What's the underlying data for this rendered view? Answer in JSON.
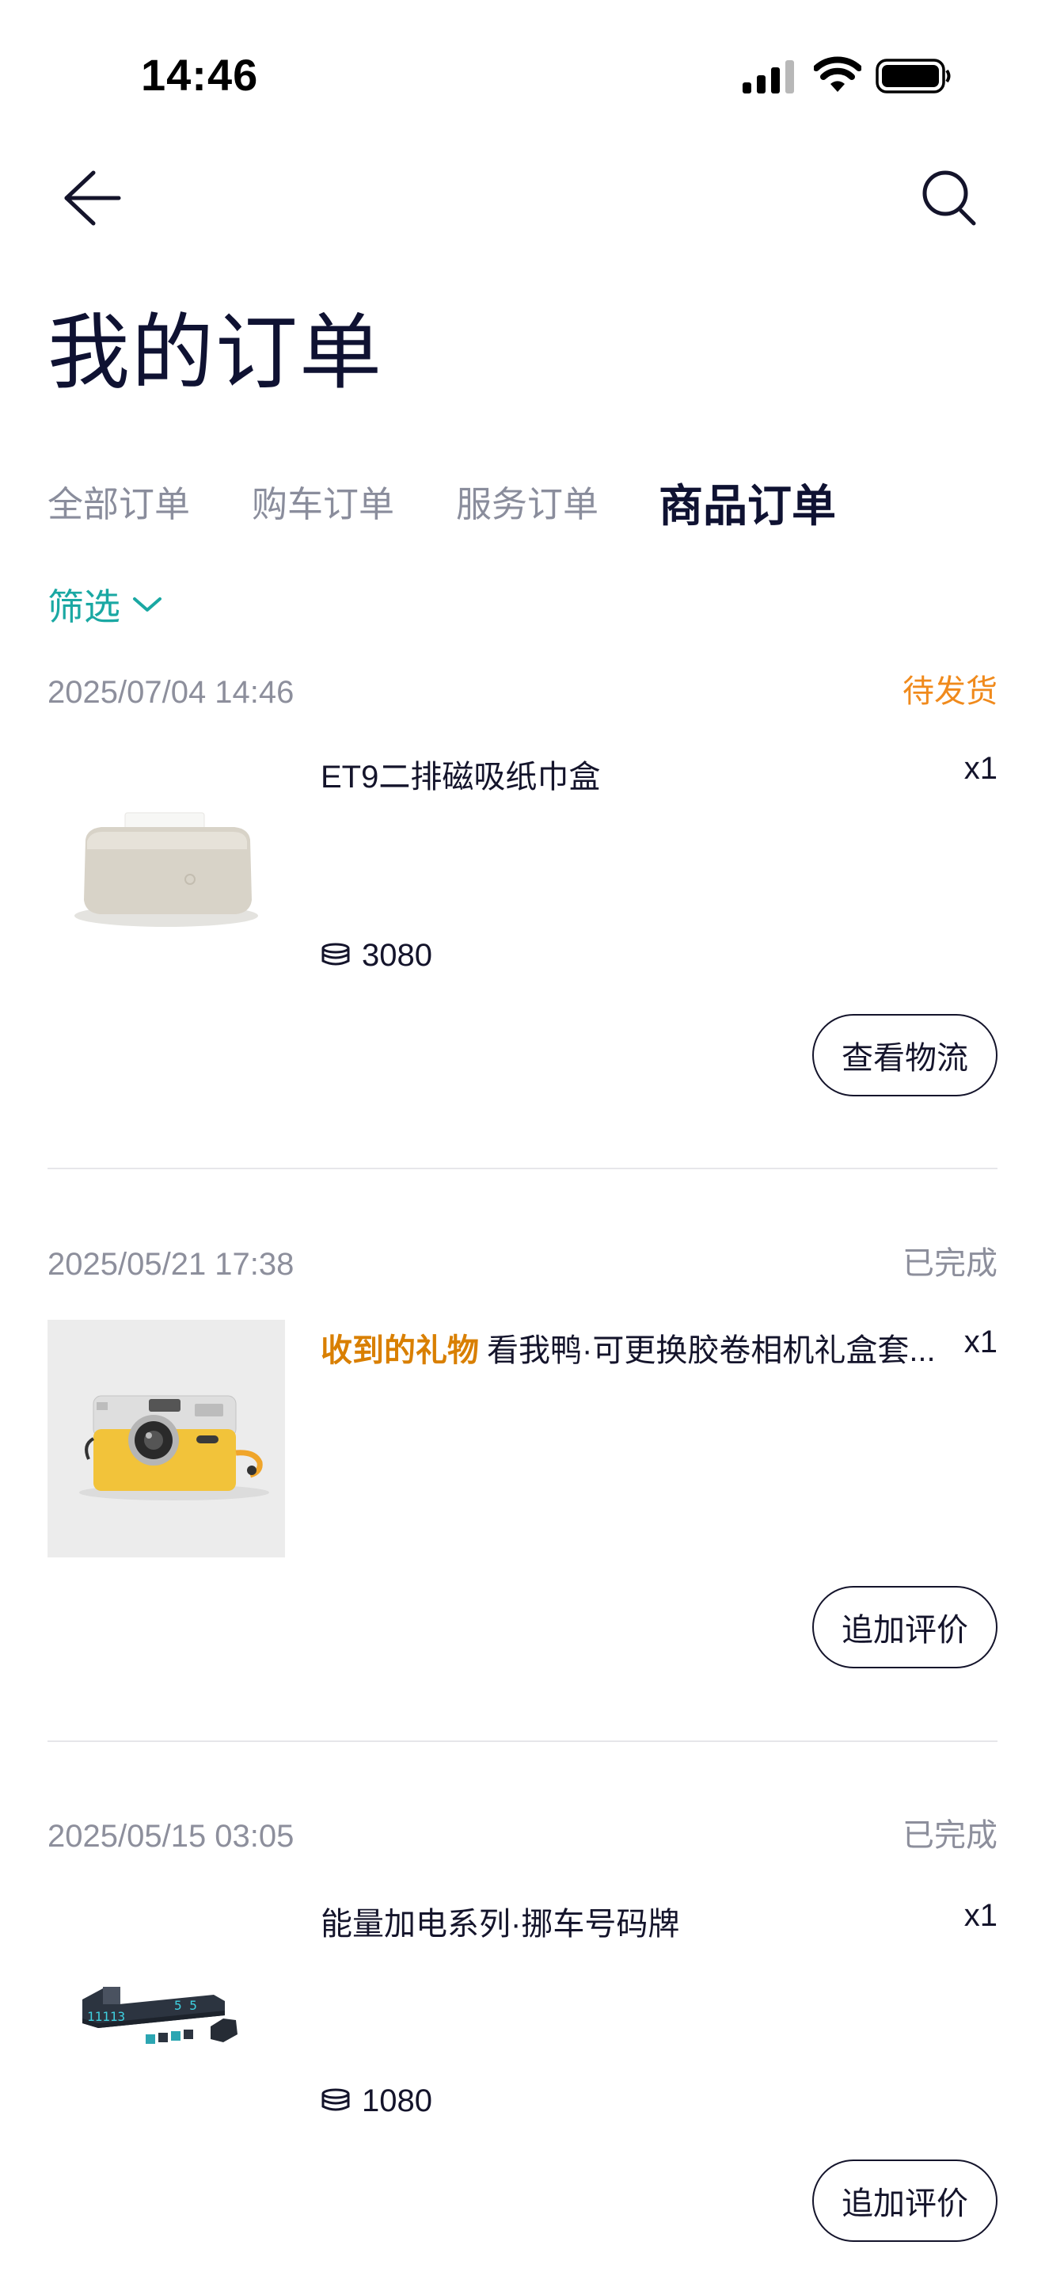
{
  "status_bar": {
    "time": "14:46"
  },
  "header": {
    "title": "我的订单"
  },
  "tabs": [
    {
      "label": "全部订单"
    },
    {
      "label": "购车订单"
    },
    {
      "label": "服务订单"
    },
    {
      "label": "商品订单"
    }
  ],
  "filter": {
    "label": "筛选"
  },
  "orders": [
    {
      "date": "2025/07/04 14:46",
      "status": "待发货",
      "status_color": "#f08a1c",
      "gift_tag": "",
      "title": "ET9二排磁吸纸巾盒",
      "qty": "x1",
      "price": "3080",
      "button": "查看物流"
    },
    {
      "date": "2025/05/21 17:38",
      "status": "已完成",
      "status_color": "#8d8f9c",
      "gift_tag": "收到的礼物",
      "title": "看我鸭·可更换胶卷相机礼盒套...",
      "qty": "x1",
      "price": "",
      "button": "追加评价"
    },
    {
      "date": "2025/05/15 03:05",
      "status": "已完成",
      "status_color": "#8d8f9c",
      "gift_tag": "",
      "title": "能量加电系列·挪车号码牌",
      "qty": "x1",
      "price": "1080",
      "button": "追加评价"
    }
  ],
  "plate_digits": {
    "left": "11113",
    "right": "5 5"
  },
  "colors": {
    "accent_teal": "#1aa8a3",
    "pending_orange": "#f08a1c",
    "gift_orange": "#d97f00",
    "text_dark": "#14142b",
    "text_grey": "#8d8f9c"
  }
}
